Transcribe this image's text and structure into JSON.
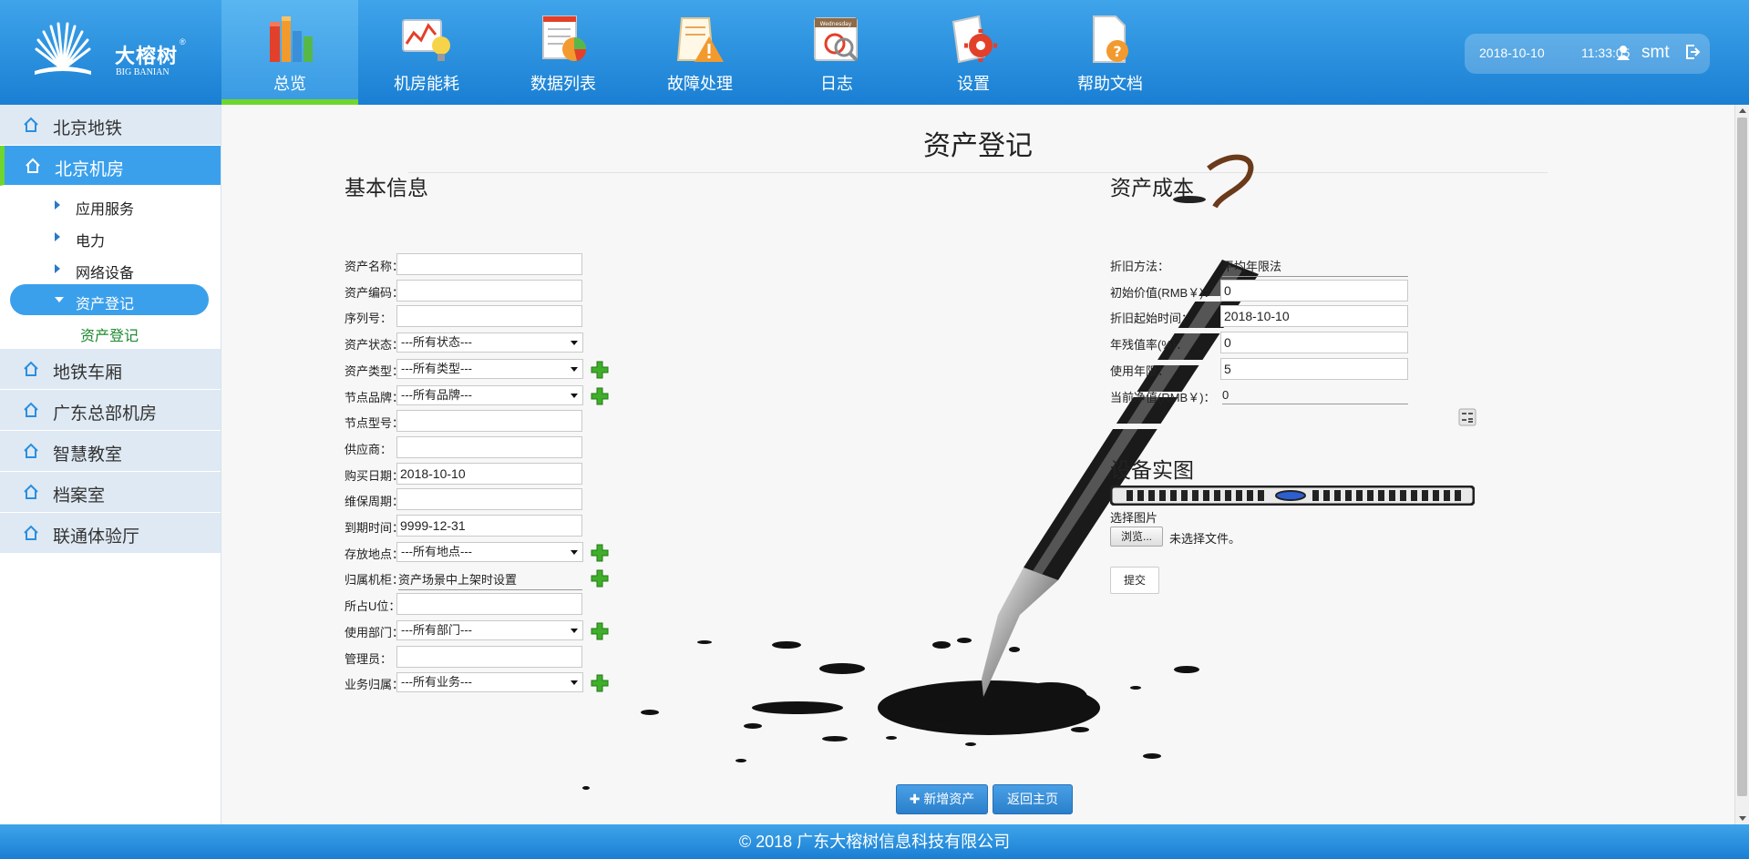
{
  "brand": {
    "name": "大榕树",
    "sub": "BIG BANIAN",
    "reg": "®"
  },
  "nav": [
    {
      "label": "总览",
      "icon": "books-icon",
      "active": true
    },
    {
      "label": "机房能耗",
      "icon": "energy-chart-icon"
    },
    {
      "label": "数据列表",
      "icon": "data-list-icon"
    },
    {
      "label": "故障处理",
      "icon": "warning-icon"
    },
    {
      "label": "日志",
      "icon": "calendar-icon"
    },
    {
      "label": "设置",
      "icon": "settings-icon"
    },
    {
      "label": "帮助文档",
      "icon": "help-doc-icon"
    }
  ],
  "calendar_text": "Wednesday",
  "user": {
    "date": "2018-10-10",
    "time": "11:33:05",
    "name": "smt"
  },
  "sidebar": {
    "items": [
      {
        "label": "北京地铁"
      },
      {
        "label": "北京机房",
        "active": true
      },
      {
        "label": "地铁车厢"
      },
      {
        "label": "广东总部机房"
      },
      {
        "label": "智慧教室"
      },
      {
        "label": "档案室"
      },
      {
        "label": "联通体验厅"
      }
    ],
    "subs": [
      {
        "label": "应用服务"
      },
      {
        "label": "电力"
      },
      {
        "label": "网络设备"
      },
      {
        "label": "资产登记",
        "active": true
      }
    ],
    "leaf": "资产登记"
  },
  "page_title": "资产登记",
  "basic": {
    "title": "基本信息",
    "fields": [
      {
        "label": "资产名称：",
        "type": "input",
        "value": ""
      },
      {
        "label": "资产编码：",
        "type": "input",
        "value": ""
      },
      {
        "label": "序列号：",
        "type": "input",
        "value": ""
      },
      {
        "label": "资产状态：",
        "type": "select",
        "value": "---所有状态---"
      },
      {
        "label": "资产类型：",
        "type": "select",
        "value": "---所有类型---",
        "plus": true
      },
      {
        "label": "节点品牌：",
        "type": "select",
        "value": "---所有品牌---",
        "plus": true
      },
      {
        "label": "节点型号：",
        "type": "input",
        "value": ""
      },
      {
        "label": "供应商：",
        "type": "input",
        "value": ""
      },
      {
        "label": "购买日期：",
        "type": "input",
        "value": "2018-10-10"
      },
      {
        "label": "维保周期：",
        "type": "input",
        "value": ""
      },
      {
        "label": "到期时间：",
        "type": "input",
        "value": "9999-12-31"
      },
      {
        "label": "存放地点：",
        "type": "select",
        "value": "---所有地点---",
        "plus": true
      },
      {
        "label": "归属机柜：",
        "type": "text",
        "value": "资产场景中上架时设置",
        "plus": true
      },
      {
        "label": "所占U位：",
        "type": "input",
        "value": ""
      },
      {
        "label": "使用部门：",
        "type": "select",
        "value": "---所有部门---",
        "plus": true
      },
      {
        "label": "管理员：",
        "type": "input",
        "value": ""
      },
      {
        "label": "业务归属：",
        "type": "select",
        "value": "---所有业务---",
        "plus": true
      }
    ]
  },
  "cost": {
    "title": "资产成本",
    "fields": [
      {
        "label": "折旧方法：",
        "value": "平均年限法",
        "plain": true
      },
      {
        "label": "初始价值(RMB￥)：",
        "value": "0"
      },
      {
        "label": "折旧起始时间：",
        "value": "2018-10-10"
      },
      {
        "label": "年残值率(%)：",
        "value": "0"
      },
      {
        "label": "使用年限：",
        "value": "5"
      },
      {
        "label": "当前净值(RMB￥)：",
        "value": "0",
        "plain": true
      }
    ]
  },
  "photo": {
    "title": "设备实图",
    "choose_label": "选择图片",
    "browse": "浏览...",
    "file_status": "未选择文件。",
    "submit": "提交"
  },
  "buttons": {
    "add": "新增资产",
    "home": "返回主页"
  },
  "footer": "© 2018  广东大榕树信息科技有限公司",
  "colors": {
    "header": "#2a8fdf",
    "accent_green": "#6fd62e",
    "leaf_green": "#1d8a2e",
    "button_blue": "#2a7fcb"
  }
}
